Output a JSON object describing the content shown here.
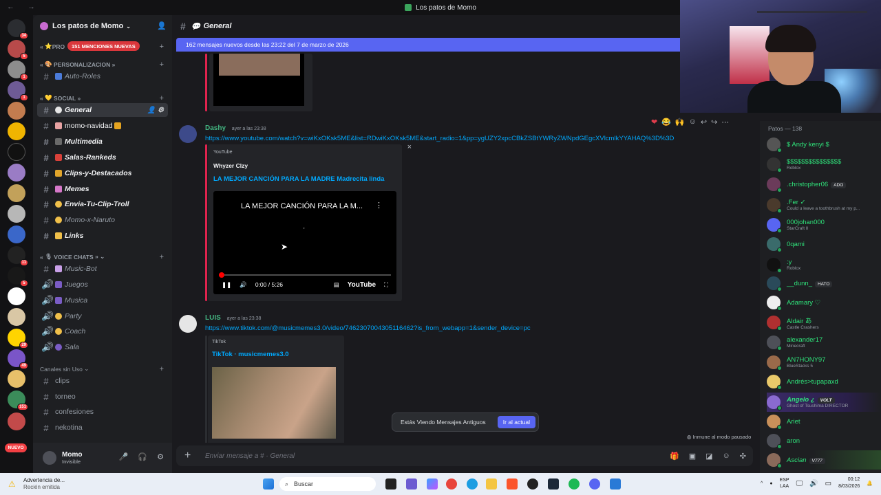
{
  "window": {
    "title": "Los patos de Momo"
  },
  "server": {
    "name": "Los patos de Momo",
    "mentions_pill": "151 MENCIONES NUEVAS"
  },
  "rail_badges": [
    "34",
    "5",
    "1",
    "1",
    "11",
    "5",
    "29",
    "49",
    "151"
  ],
  "rail_nuevo": "NUEVO",
  "categories": {
    "pro": "PRO",
    "personalizacion": "PERSONALIZACION",
    "social": "SOCIAL",
    "voice": "VOICE CHATS",
    "unused": "Canales sin Uso"
  },
  "channels": {
    "autoroles": "Auto-Roles",
    "general": "General",
    "momo_navidad": "momo-navidad",
    "multimedia": "Multimedia",
    "salas": "Salas-Rankeds",
    "clips_dest": "Clips-y-Destacados",
    "memes": "Memes",
    "envia": "Envia-Tu-Clip-Troll",
    "naruto": "Momo-x-Naruto",
    "links": "Links",
    "music_bot": "Music-Bot",
    "juegos": "Juegos",
    "musica": "Musica",
    "party": "Party",
    "coach": "Coach",
    "sala": "Sala",
    "clips": "clips",
    "torneo": "torneo",
    "confesiones": "confesiones",
    "nekotina": "nekotina"
  },
  "user": {
    "name": "Momo",
    "status": "Invisible"
  },
  "chat": {
    "channel": "General",
    "new_messages_bar": "162 mensajes nuevos desde las 23:22 del 7 de marzo de 2026",
    "composer_placeholder": "Enviar mensaje a # · General",
    "old_messages": "Estás Viendo Mensajes Antiguos",
    "jump_button": "Ir al actual",
    "immune": "Inmune al modo pausado"
  },
  "messages": [
    {
      "author": "Dashy",
      "time": "ayer a las 23:38",
      "link": "https://www.youtube.com/watch?v=wiKxOKsk5ME&list=RDwiKxOKsk5ME&start_radio=1&pp=ygUZY2xpcCBkZSBtYWRyZWNpdGEgcXVlcmlkYYAHAQ%3D%3D",
      "embed": {
        "provider": "YouTube",
        "author": "Whyzer Clzy",
        "title": "LA MEJOR CANCIÓN PARA  LA MADRE  Madrecita linda",
        "video_title": "LA MEJOR CANCIÓN PARA LA M...",
        "video_time": "0:00 / 5:26",
        "brand": "YouTube"
      }
    },
    {
      "author": "LUIS",
      "time": "ayer a las 23:38",
      "link": "https://www.tiktok.com/@musicmemes3.0/video/7462307004305116462?is_from_webapp=1&sender_device=pc",
      "embed": {
        "provider": "TikTok",
        "title": "TikTok · musicmemes3.0"
      }
    }
  ],
  "members": {
    "header": "Patos — 138",
    "list": [
      {
        "name": "$ Andy kenyi $",
        "activity": ""
      },
      {
        "name": "$$$$$$$$$$$$$$$",
        "activity": "Roblox"
      },
      {
        "name": ".christopher06",
        "activity": "",
        "tag": "ADO"
      },
      {
        "name": ".Fer ✓",
        "activity": "Could u leave a toothbrush at my p..."
      },
      {
        "name": "000johan000",
        "activity": "StarCraft II"
      },
      {
        "name": "0qami",
        "activity": ""
      },
      {
        "name": ":y",
        "activity": "Roblox"
      },
      {
        "name": "__dunn_",
        "activity": "",
        "tag": "HATO"
      },
      {
        "name": "Adamary ♡",
        "activity": ""
      },
      {
        "name": "Aldair あ",
        "activity": "Castle Crashers"
      },
      {
        "name": "alexander17",
        "activity": "Minecraft"
      },
      {
        "name": "AN7HONY97",
        "activity": "BlueStacks 5"
      },
      {
        "name": "Andrés>tupapaxd",
        "activity": ""
      },
      {
        "name": "Angelo ¿",
        "activity": "Ghost of Tsushima DIRECTOR",
        "tag": "VOLT"
      },
      {
        "name": "Ariet",
        "activity": ""
      },
      {
        "name": "aron",
        "activity": ""
      },
      {
        "name": "Ascian",
        "activity": "",
        "tag": "V777"
      }
    ]
  },
  "taskbar": {
    "notice_title": "Advertencia de...",
    "notice_sub": "Recién emitida",
    "search": "Buscar",
    "lang1": "ESP",
    "lang2": "LAA",
    "time": "00:12",
    "date": "8/03/2026"
  },
  "colors": {
    "accent": "#5865f2",
    "online_name": "#2fe27a",
    "link": "#00a8fc",
    "youtube_bar": "#e0234e"
  }
}
